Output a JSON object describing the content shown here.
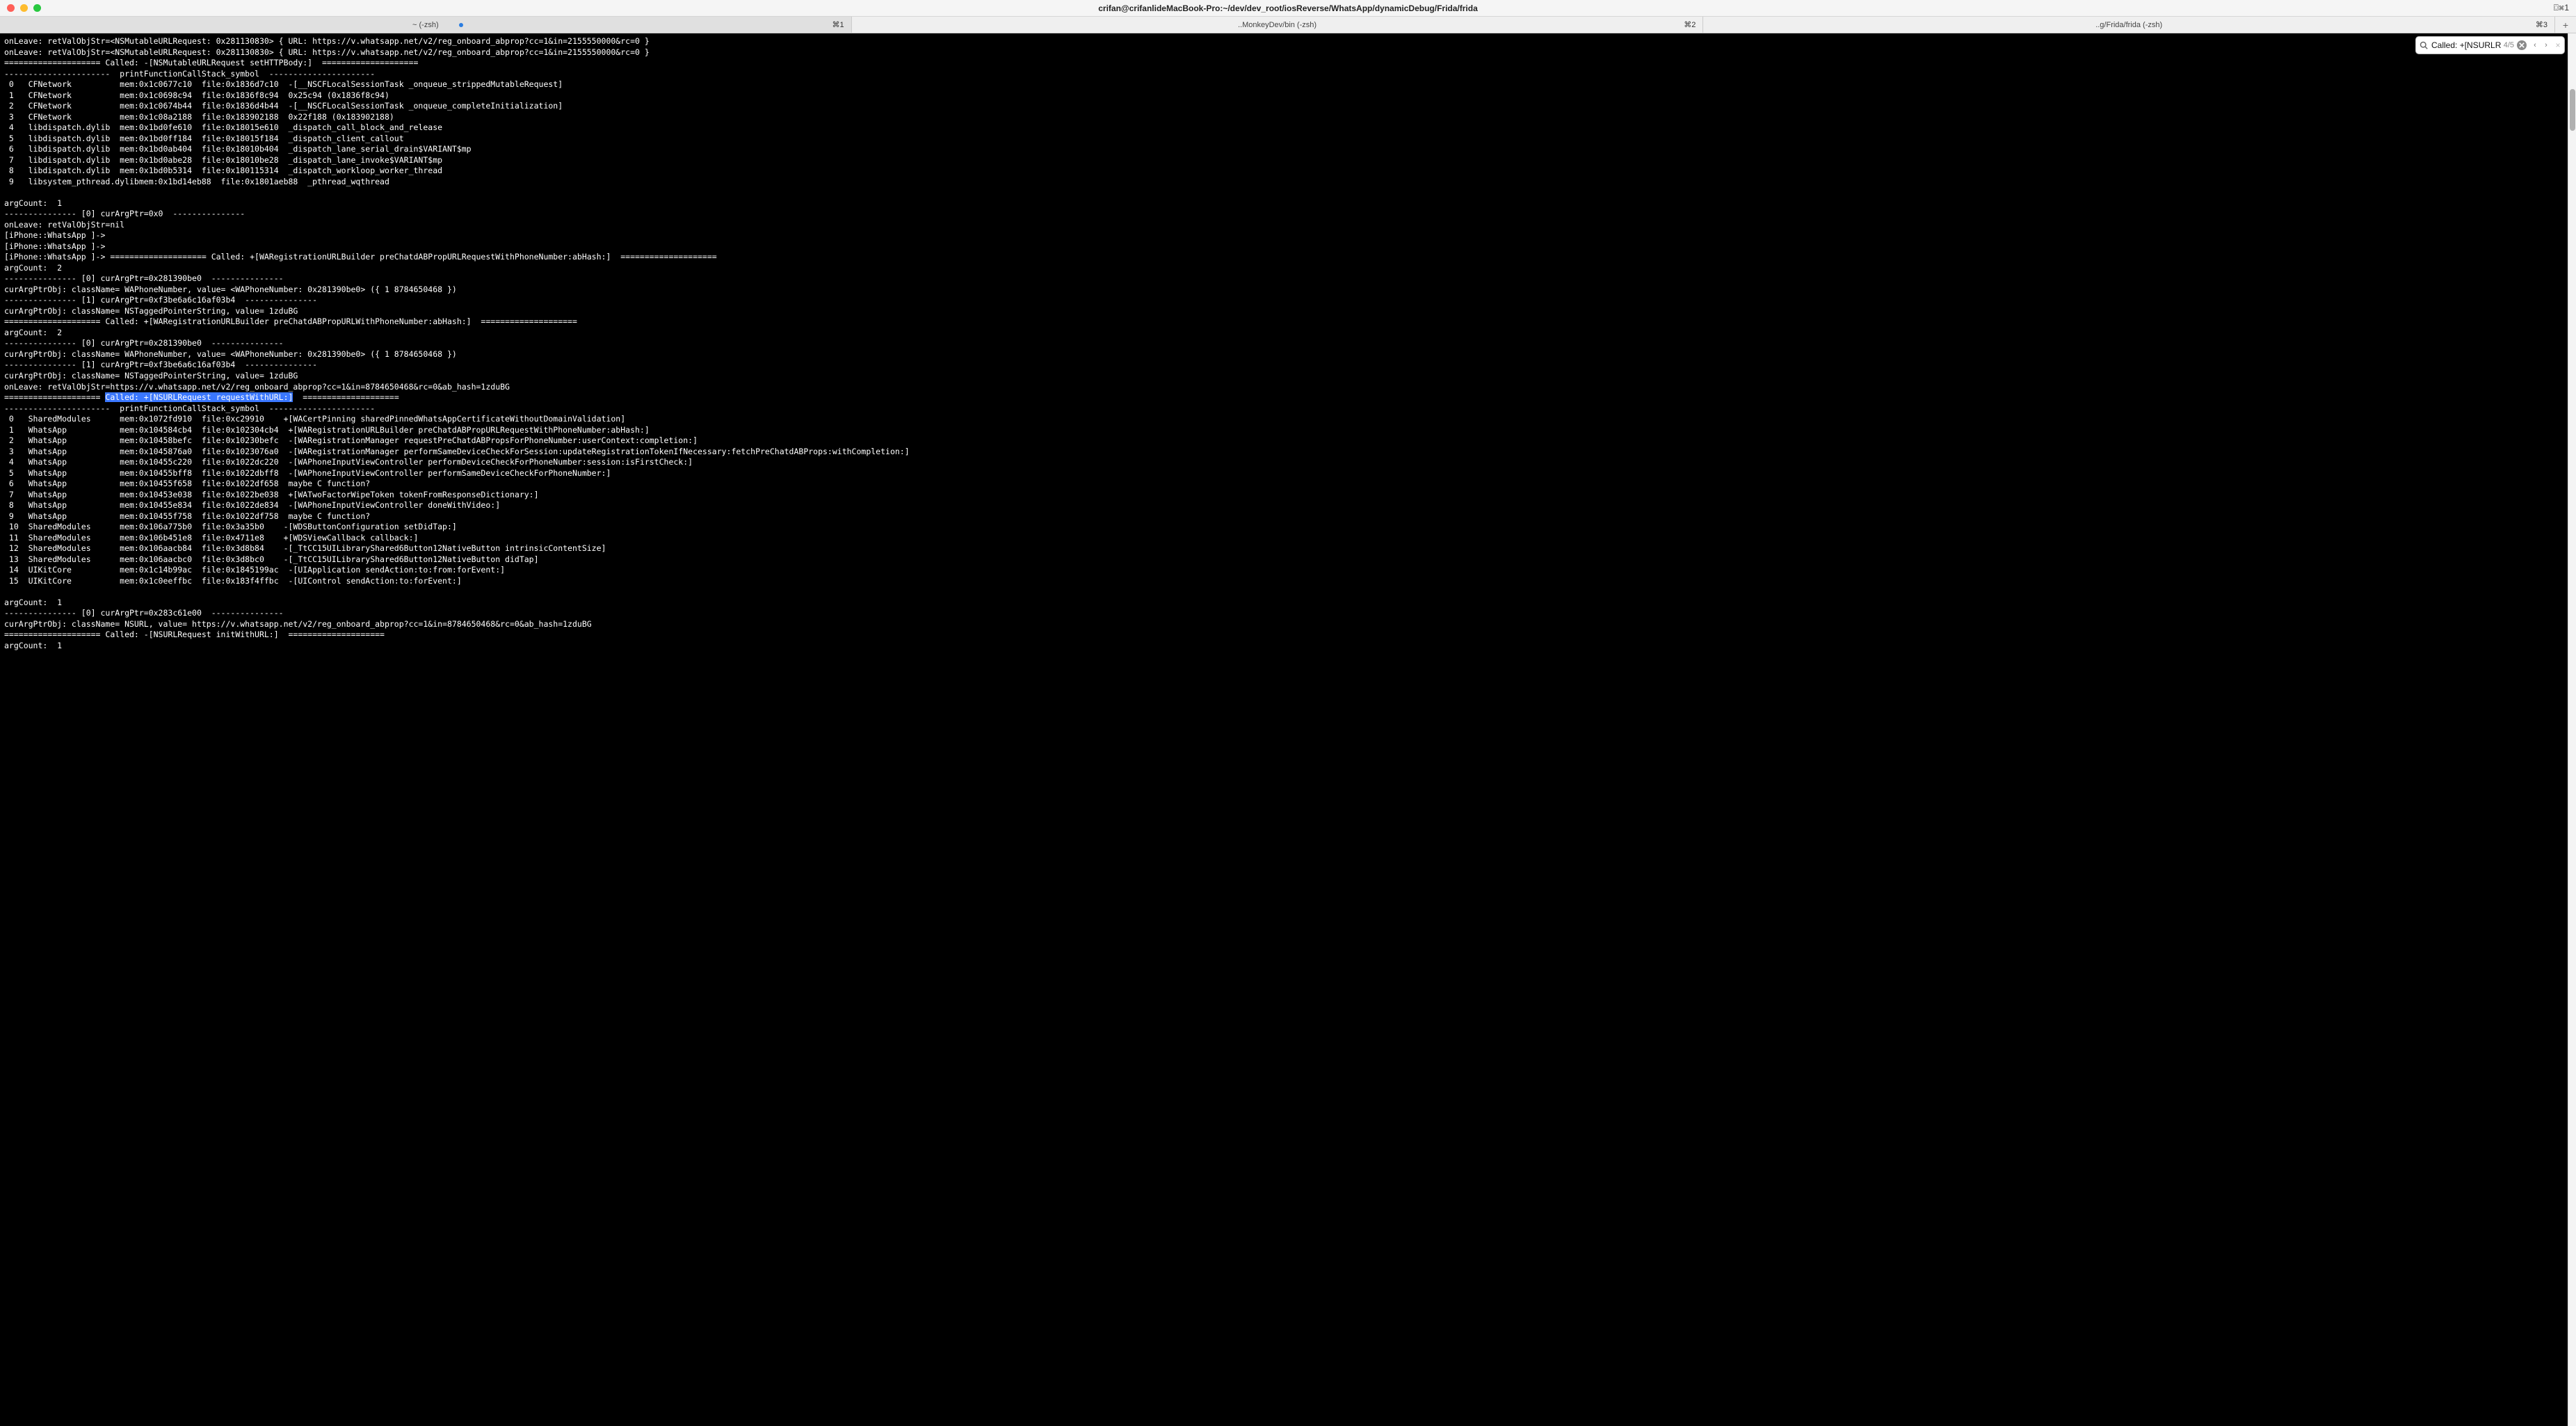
{
  "titlebar": {
    "title": "crifan@crifanlideMacBook-Pro:~/dev/dev_root/iosReverse/WhatsApp/dynamicDebug/Frida/frida",
    "shortcut": "⌼⌘1"
  },
  "tabs": {
    "items": [
      {
        "label": "~ (-zsh)",
        "shortcut": "⌘1",
        "active": true,
        "dotted": true
      },
      {
        "label": "..MonkeyDev/bin (-zsh)",
        "shortcut": "⌘2",
        "active": false,
        "dotted": false
      },
      {
        "label": "..g/Frida/frida (-zsh)",
        "shortcut": "⌘3",
        "active": false,
        "dotted": false
      }
    ],
    "add_label": "+"
  },
  "search": {
    "icon": "search",
    "query": "Called: +[NSURLRe",
    "count": "4/5",
    "clear": "×",
    "prev": "‹",
    "next": "›",
    "close": "×"
  },
  "highlight_text": "Called: +[NSURLRequest requestWithURL:]",
  "terminal_lines": [
    "onLeave: retValObjStr=<NSMutableURLRequest: 0x281130830> { URL: https://v.whatsapp.net/v2/reg_onboard_abprop?cc=1&in=2155550000&rc=0 }",
    "onLeave: retValObjStr=<NSMutableURLRequest: 0x281130830> { URL: https://v.whatsapp.net/v2/reg_onboard_abprop?cc=1&in=2155550000&rc=0 }",
    "==================== Called: -[NSMutableURLRequest setHTTPBody:]  ====================",
    "----------------------  printFunctionCallStack_symbol  ----------------------",
    " 0   CFNetwork          mem:0x1c0677c10  file:0x1836d7c10  -[__NSCFLocalSessionTask _onqueue_strippedMutableRequest]",
    " 1   CFNetwork          mem:0x1c0698c94  file:0x1836f8c94  0x25c94 (0x1836f8c94)",
    " 2   CFNetwork          mem:0x1c0674b44  file:0x1836d4b44  -[__NSCFLocalSessionTask _onqueue_completeInitialization]",
    " 3   CFNetwork          mem:0x1c08a2188  file:0x183902188  0x22f188 (0x183902188)",
    " 4   libdispatch.dylib  mem:0x1bd0fe610  file:0x18015e610  _dispatch_call_block_and_release",
    " 5   libdispatch.dylib  mem:0x1bd0ff184  file:0x18015f184  _dispatch_client_callout",
    " 6   libdispatch.dylib  mem:0x1bd0ab404  file:0x18010b404  _dispatch_lane_serial_drain$VARIANT$mp",
    " 7   libdispatch.dylib  mem:0x1bd0abe28  file:0x18010be28  _dispatch_lane_invoke$VARIANT$mp",
    " 8   libdispatch.dylib  mem:0x1bd0b5314  file:0x180115314  _dispatch_workloop_worker_thread",
    " 9   libsystem_pthread.dylibmem:0x1bd14eb88  file:0x1801aeb88  _pthread_wqthread",
    "",
    "argCount:  1",
    "--------------- [0] curArgPtr=0x0  ---------------",
    "onLeave: retValObjStr=nil",
    "[iPhone::WhatsApp ]->",
    "[iPhone::WhatsApp ]->",
    "[iPhone::WhatsApp ]-> ==================== Called: +[WARegistrationURLBuilder preChatdABPropURLRequestWithPhoneNumber:abHash:]  ====================",
    "argCount:  2",
    "--------------- [0] curArgPtr=0x281390be0  ---------------",
    "curArgPtrObj: className= WAPhoneNumber, value= <WAPhoneNumber: 0x281390be0> ({ 1 8784650468 })",
    "--------------- [1] curArgPtr=0xf3be6a6c16af03b4  ---------------",
    "curArgPtrObj: className= NSTaggedPointerString, value= 1zduBG",
    "==================== Called: +[WARegistrationURLBuilder preChatdABPropURLWithPhoneNumber:abHash:]  ====================",
    "argCount:  2",
    "--------------- [0] curArgPtr=0x281390be0  ---------------",
    "curArgPtrObj: className= WAPhoneNumber, value= <WAPhoneNumber: 0x281390be0> ({ 1 8784650468 })",
    "--------------- [1] curArgPtr=0xf3be6a6c16af03b4  ---------------",
    "curArgPtrObj: className= NSTaggedPointerString, value= 1zduBG",
    "onLeave: retValObjStr=https://v.whatsapp.net/v2/reg_onboard_abprop?cc=1&in=8784650468&rc=0&ab_hash=1zduBG",
    "==================== {{HIGHLIGHT}}  ====================",
    "----------------------  printFunctionCallStack_symbol  ----------------------",
    " 0   SharedModules      mem:0x1072fd910  file:0xc29910    +[WACertPinning sharedPinnedWhatsAppCertificateWithoutDomainValidation]",
    " 1   WhatsApp           mem:0x104584cb4  file:0x102304cb4  +[WARegistrationURLBuilder preChatdABPropURLRequestWithPhoneNumber:abHash:]",
    " 2   WhatsApp           mem:0x10458befc  file:0x10230befc  -[WARegistrationManager requestPreChatdABPropsForPhoneNumber:userContext:completion:]",
    " 3   WhatsApp           mem:0x1045876a0  file:0x1023076a0  -[WARegistrationManager performSameDeviceCheckForSession:updateRegistrationTokenIfNecessary:fetchPreChatdABProps:withCompletion:]",
    " 4   WhatsApp           mem:0x10455c220  file:0x1022dc220  -[WAPhoneInputViewController performDeviceCheckForPhoneNumber:session:isFirstCheck:]",
    " 5   WhatsApp           mem:0x10455bff8  file:0x1022dbff8  -[WAPhoneInputViewController performSameDeviceCheckForPhoneNumber:]",
    " 6   WhatsApp           mem:0x10455f658  file:0x1022df658  maybe C function?",
    " 7   WhatsApp           mem:0x10453e038  file:0x1022be038  +[WATwoFactorWipeToken tokenFromResponseDictionary:]",
    " 8   WhatsApp           mem:0x10455e834  file:0x1022de834  -[WAPhoneInputViewController doneWithVideo:]",
    " 9   WhatsApp           mem:0x10455f758  file:0x1022df758  maybe C function?",
    " 10  SharedModules      mem:0x106a775b0  file:0x3a35b0    -[WDSButtonConfiguration setDidTap:]",
    " 11  SharedModules      mem:0x106b451e8  file:0x4711e8    +[WDSViewCallback callback:]",
    " 12  SharedModules      mem:0x106aacb84  file:0x3d8b84    -[_TtCC15UILibraryShared6Button12NativeButton intrinsicContentSize]",
    " 13  SharedModules      mem:0x106aacbc0  file:0x3d8bc0    -[_TtCC15UILibraryShared6Button12NativeButton didTap]",
    " 14  UIKitCore          mem:0x1c14b99ac  file:0x1845199ac  -[UIApplication sendAction:to:from:forEvent:]",
    " 15  UIKitCore          mem:0x1c0eeffbc  file:0x183f4ffbc  -[UIControl sendAction:to:forEvent:]",
    "",
    "argCount:  1",
    "--------------- [0] curArgPtr=0x283c61e00  ---------------",
    "curArgPtrObj: className= NSURL, value= https://v.whatsapp.net/v2/reg_onboard_abprop?cc=1&in=8784650468&rc=0&ab_hash=1zduBG",
    "==================== Called: -[NSURLRequest initWithURL:]  ====================",
    "argCount:  1"
  ]
}
